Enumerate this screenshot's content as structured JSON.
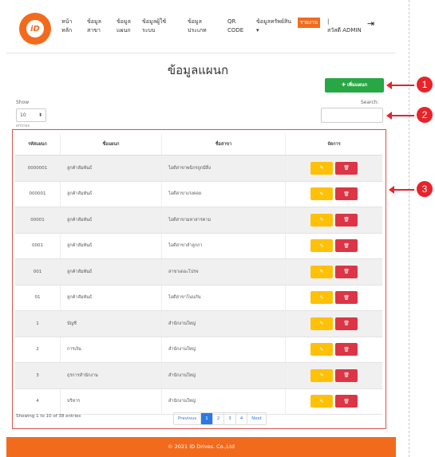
{
  "nav": {
    "logo_text": "iD",
    "items": [
      {
        "line1": "หน้า",
        "line2": "หลัก"
      },
      {
        "line1": "ข้อมูล",
        "line2": "สาขา"
      },
      {
        "line1": "ข้อมูล",
        "line2": "แผนก"
      },
      {
        "line1": "ข้อมูลผู้ใช้",
        "line2": "ระบบ"
      },
      {
        "line1": "ข้อมูล",
        "line2": "ประเภท"
      },
      {
        "line1": "QR",
        "line2": "CODE"
      },
      {
        "line1": "ข้อมูลทรัพย์สิน",
        "line2": "▾"
      }
    ],
    "report": "รายงาน",
    "user_line1": "|",
    "user_line2": "สวัสดี ADMIN"
  },
  "page": {
    "title": "ข้อมูลแผนก",
    "add_button": "✚ เพิ่มแผนก"
  },
  "controls": {
    "show_label": "Show",
    "show_value": "10",
    "entries_label": "entries",
    "search_label": "Search:"
  },
  "table": {
    "headers": [
      "รหัสแผนก",
      "ชื่อแผนก",
      "ชื่อสาขา",
      "จัดการ"
    ],
    "rows": [
      {
        "code": "0000001",
        "name": "ลูกค้าสัมพันธ์",
        "branch": "ไอดีสาขาพนิกรถูกมีสิ่ง"
      },
      {
        "code": "000001",
        "name": "ลูกค้าสัมพันธ์",
        "branch": "ไอดีสาขาเก่งคอย"
      },
      {
        "code": "00001",
        "name": "ลูกค้าสัมพันธ์",
        "branch": "ไอดีสาขามหาสารคาม"
      },
      {
        "code": "0001",
        "name": "ลูกค้าสัมพันธ์",
        "branch": "ไอดีสาขาลำลูกกา"
      },
      {
        "code": "001",
        "name": "ลูกค้าสัมพันธ์",
        "branch": "สาขาเดอะโปรจ"
      },
      {
        "code": "01",
        "name": "ลูกค้าสัมพันธ์",
        "branch": "ไอดีสาขาโนนกัน"
      },
      {
        "code": "1",
        "name": "บัญชี",
        "branch": "สำนักงานใหญ่"
      },
      {
        "code": "2",
        "name": "การเงิน",
        "branch": "สำนักงานใหญ่"
      },
      {
        "code": "3",
        "name": "ธุรการสำนักงาน",
        "branch": "สำนักงานใหญ่"
      },
      {
        "code": "4",
        "name": "บริหาร",
        "branch": "สำนักงานใหญ่"
      }
    ]
  },
  "pagination": {
    "info": "Showing 1 to 10 of 38 entries",
    "previous": "Previous",
    "pages": [
      "1",
      "2",
      "3",
      "4"
    ],
    "next": "Next"
  },
  "footer": "© 2021 ID Drives. Co.,Ltd",
  "callouts": [
    "1",
    "2",
    "3"
  ],
  "colors": {
    "brand": "#f26b1d",
    "add": "#28a745",
    "edit": "#ffc107",
    "delete": "#dc3545",
    "callout": "#e8232a"
  }
}
